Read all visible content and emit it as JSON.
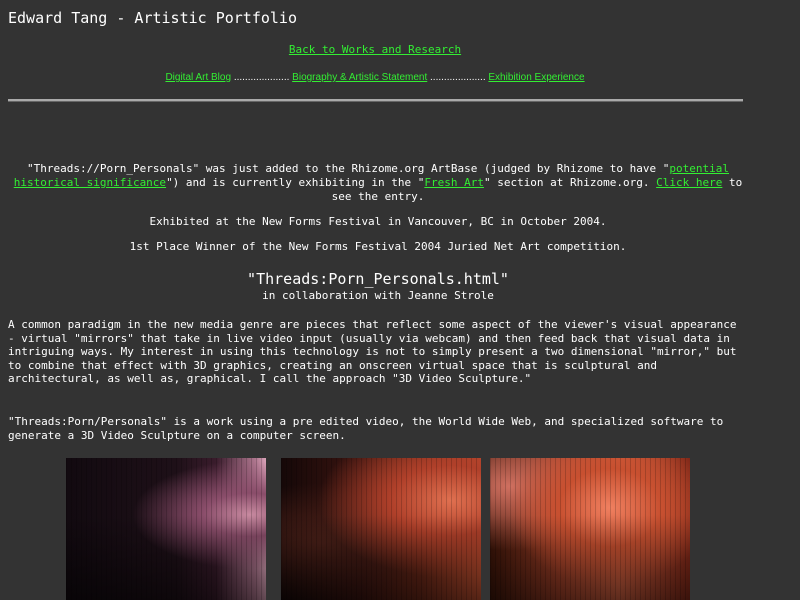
{
  "header": {
    "title": "Edward Tang - Artistic Portfolio"
  },
  "nav": {
    "back_link": "Back to Works and Research",
    "links": [
      "Digital Art Blog",
      "Biography & Artistic Statement",
      "Exhibition Experience"
    ],
    "separator": "...................."
  },
  "announcement": {
    "part1": "\"Threads://Porn_Personals\" was just added to the Rhizome.org ArtBase (judged by Rhizome to have \"",
    "link1": "potential historical significance",
    "part2": "\") and is currently exhibiting in the \"",
    "link2": "Fresh Art",
    "part3": "\" section at Rhizome.org. ",
    "link3": "Click here",
    "part4": " to see the entry."
  },
  "exhibited": "Exhibited at the New Forms Festival in Vancouver, BC in October 2004.",
  "award": "1st Place Winner of the New Forms Festival 2004 Juried Net Art competition.",
  "work": {
    "title": "\"Threads:Porn_Personals.html\"",
    "collaboration": "in collaboration with Jeanne Strole"
  },
  "body": {
    "paragraph1": "A common paradigm in the new media genre are pieces that reflect some aspect of the viewer's visual appearance - virtual \"mirrors\" that take in live video input (usually via webcam) and then feed back that visual data in intriguing ways. My interest in using this technology is not to simply present a two dimensional \"mirror,\" but to combine that effect with 3D graphics, creating an onscreen virtual space that is sculptural and architectural, as well as, graphical. I call the approach \"3D Video Sculpture.\"",
    "paragraph2": "\"Threads:Porn/Personals\" is a work using a pre edited video, the World Wide Web, and specialized software to generate a 3D Video Sculpture on a computer screen."
  },
  "colors": {
    "background": "#333333",
    "link": "#33ee33",
    "text": "#ffffff"
  }
}
